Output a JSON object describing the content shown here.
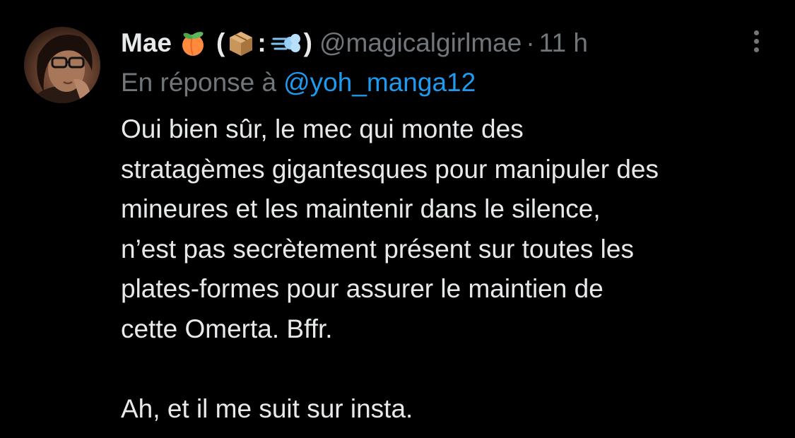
{
  "tweet": {
    "display_name": "Mae",
    "name_suffix_open": "(",
    "name_suffix_colon": ":",
    "name_suffix_close": ")",
    "emojis": [
      "peach-emoji",
      "package-emoji",
      "dash-emoji"
    ],
    "handle": "@magicalgirlmae",
    "separator": "·",
    "time": "11 h",
    "reply_prefix": "En réponse à",
    "reply_to": "@yoh_manga12",
    "body_lines": [
      "Oui bien sûr, le mec qui monte des",
      "stratagèmes gigantesques pour manipuler des",
      "mineures et les maintenir dans le silence,",
      "n’est pas secrètement présent sur toutes les",
      "plates-formes pour assurer le maintien de",
      "cette Omerta. Bffr."
    ],
    "body_second_paragraph": "Ah, et il me suit sur insta.",
    "more_icon": "more-vertical-icon"
  },
  "colors": {
    "background": "#000000",
    "text_primary": "#e7e9ea",
    "text_secondary": "#71767b",
    "accent": "#1d9bf0"
  }
}
